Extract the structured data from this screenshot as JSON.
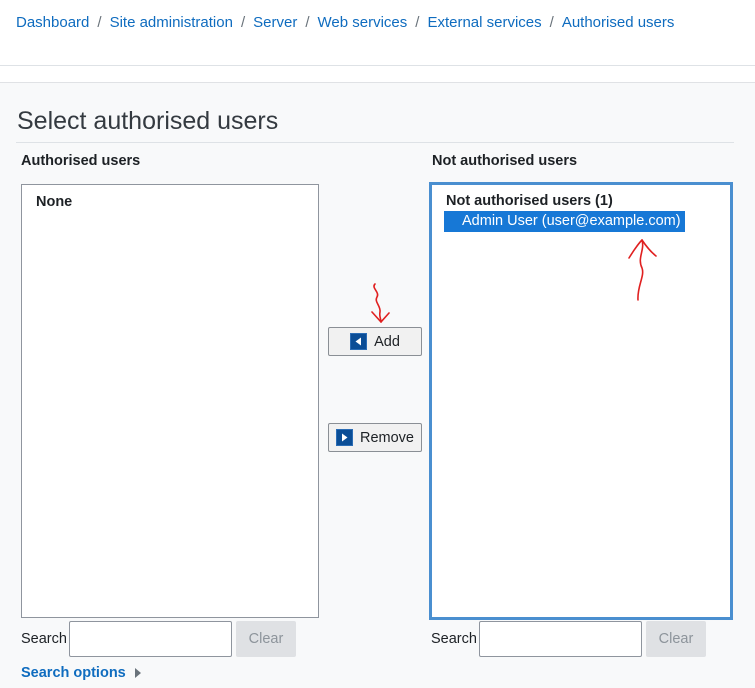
{
  "breadcrumb": {
    "items": [
      "Dashboard",
      "Site administration",
      "Server",
      "Web services",
      "External services",
      "Authorised users"
    ],
    "separator": "/"
  },
  "page": {
    "title": "Select authorised users"
  },
  "authorised": {
    "label": "Authorised users",
    "list_placeholder": "None",
    "search_label": "Search",
    "search_value": "",
    "clear_label": "Clear"
  },
  "not_authorised": {
    "label": "Not authorised users",
    "group_label": "Not authorised users (1)",
    "options": [
      {
        "label": "Admin User (user@example.com)",
        "selected": true
      }
    ],
    "search_label": "Search",
    "search_value": "",
    "clear_label": "Clear"
  },
  "actions": {
    "add_label": "Add",
    "remove_label": "Remove"
  },
  "search_options": {
    "label": "Search options"
  },
  "colors": {
    "link": "#0f6cbf",
    "selection": "#1778d6",
    "focus_border": "#4a8fd0",
    "annotation": "#e02020"
  }
}
